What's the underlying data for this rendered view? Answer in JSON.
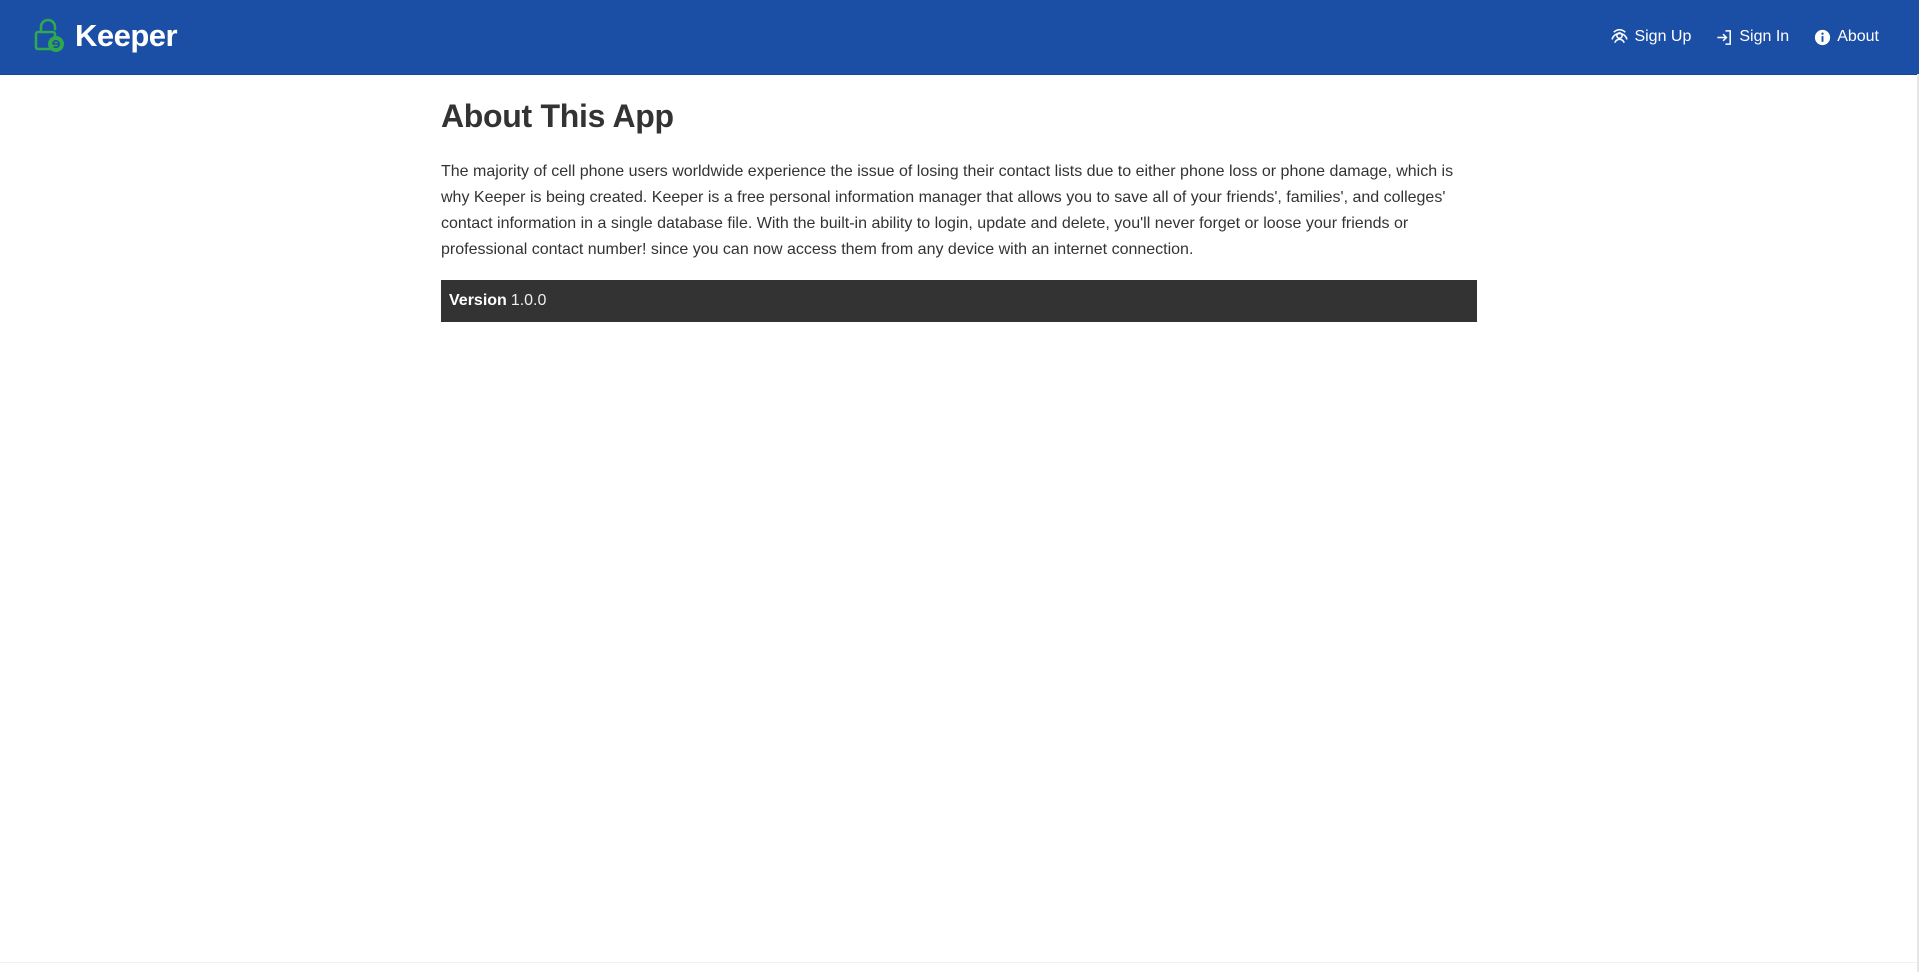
{
  "app": {
    "title": "Keeper",
    "brand_color": "#1b4ea5",
    "logo_color": "#2fa84f",
    "logo_icon": "lock-icon"
  },
  "nav": {
    "items": [
      {
        "label": "Sign Up",
        "icon": "user-circle-icon"
      },
      {
        "label": "Sign In",
        "icon": "sign-in-icon"
      },
      {
        "label": "About",
        "icon": "info-icon"
      }
    ]
  },
  "main": {
    "title": "About This App",
    "description": "The majority of cell phone users worldwide experience the issue of losing their contact lists due to either phone loss or phone damage, which is why Keeper is being created. Keeper is a free personal information manager that allows you to save all of your friends', families', and colleges' contact information in a single database file. With the built-in ability to login, update and delete, you'll never forget or loose your friends or professional contact number! since you can now access them from any device with an internet connection.",
    "version_label": "Version",
    "version_value": "1.0.0",
    "version_bar_color": "#333333"
  }
}
